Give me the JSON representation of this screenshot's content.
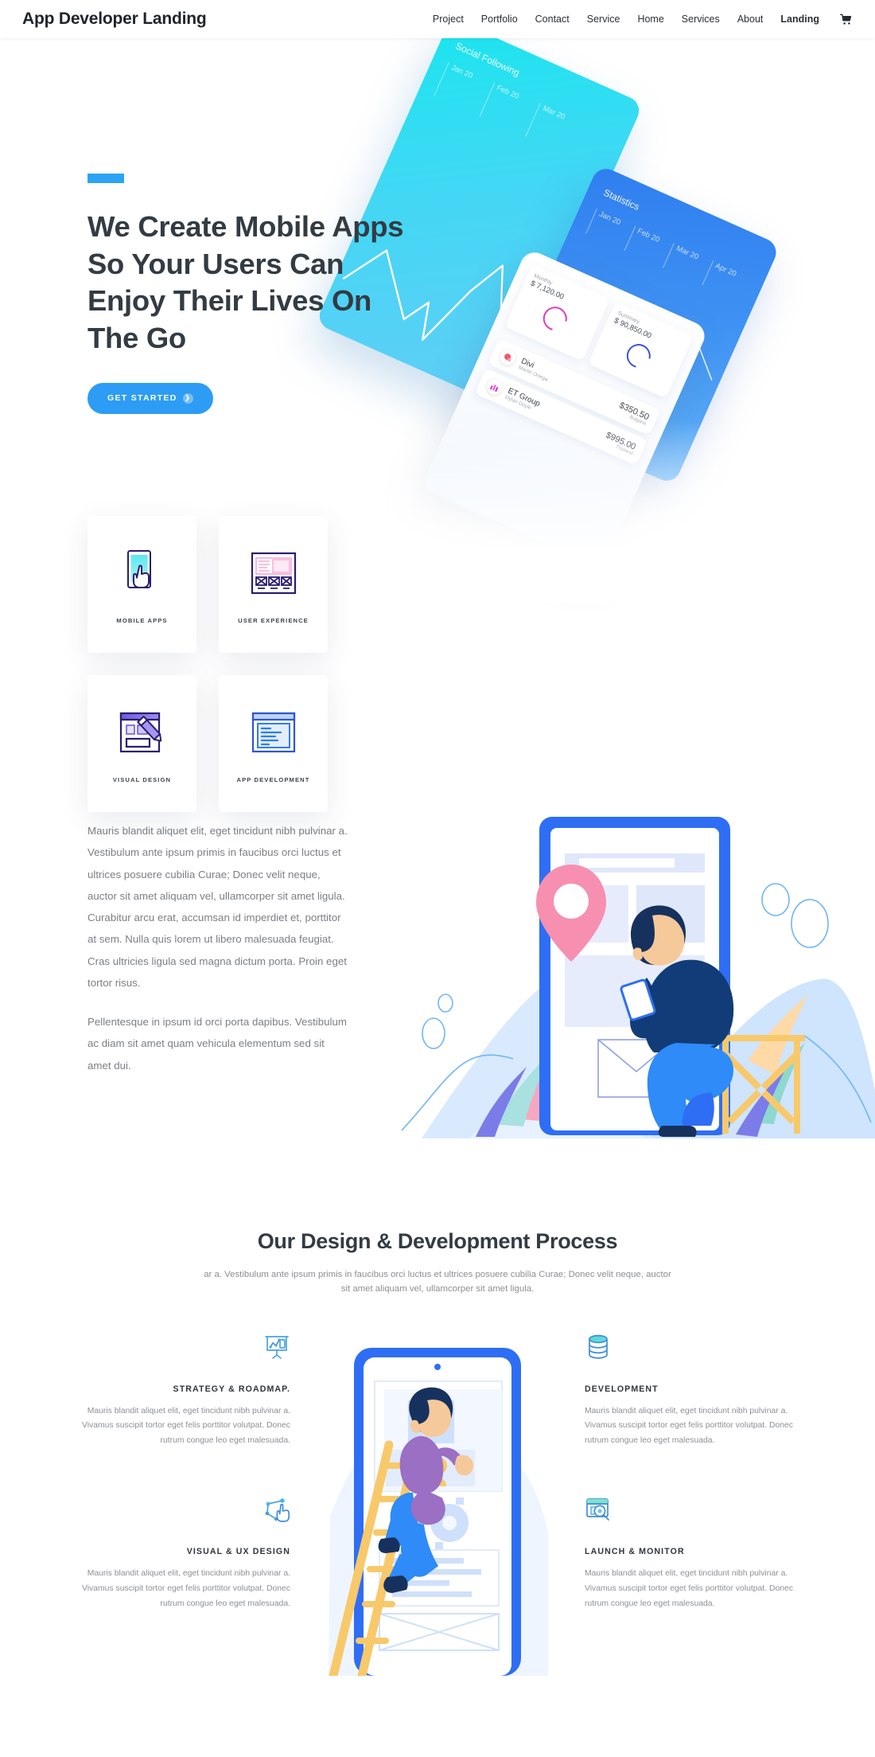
{
  "header": {
    "logo": "App Developer Landing",
    "nav": [
      {
        "label": "Project",
        "active": false
      },
      {
        "label": "Portfolio",
        "active": false
      },
      {
        "label": "Contact",
        "active": false
      },
      {
        "label": "Service",
        "active": false
      },
      {
        "label": "Home",
        "active": false
      },
      {
        "label": "Services",
        "active": false
      },
      {
        "label": "About",
        "active": false
      },
      {
        "label": "Landing",
        "active": true
      }
    ],
    "cart_icon": "shopping-cart-icon"
  },
  "hero": {
    "accent_color": "#2ca4f3",
    "title": "We Create Mobile Apps So Your Users Can Enjoy Their Lives On The Go",
    "cta_label": "GET STARTED",
    "cta_icon": "chevron-right-circle-icon",
    "cards": [
      {
        "label": "MOBILE APPS",
        "icon": "phone-tap-icon"
      },
      {
        "label": "USER EXPERIENCE",
        "icon": "wireframe-layout-icon"
      },
      {
        "label": "VISUAL DESIGN",
        "icon": "pencil-canvas-icon"
      },
      {
        "label": "APP DEVELOPMENT",
        "icon": "code-window-icon"
      }
    ],
    "art": {
      "social_card": {
        "title": "Social Following",
        "months": [
          "Jan 20",
          "Feb 20",
          "Mar 20"
        ]
      },
      "stats_card": {
        "title": "Statistics",
        "months": [
          "Jan 20",
          "Feb 20",
          "Mar 20",
          "Apr 20"
        ]
      },
      "dashboard_card": {
        "tiles": [
          {
            "caption": "Monthly",
            "value": "$ 7,120.00",
            "ring": "pink"
          },
          {
            "caption": "Summary",
            "value": "$ 90,850.00",
            "ring": "blue"
          }
        ],
        "transactions": [
          {
            "name": "Divi",
            "person": "Martin Ortega",
            "amount": "$350.50",
            "country": "Bulgaria"
          },
          {
            "name": "ET Group",
            "person": "Dylan Doyle",
            "amount": "$995.00",
            "country": "Thailand"
          }
        ]
      }
    }
  },
  "about": {
    "paragraph1": "Mauris blandit aliquet elit, eget tincidunt nibh pulvinar a. Vestibulum ante ipsum primis in faucibus orci luctus et ultrices posuere cubilia Curae; Donec velit neque, auctor sit amet aliquam vel, ullamcorper sit amet ligula. Curabitur arcu erat, accumsan id imperdiet et, porttitor at sem. Nulla quis lorem ut libero malesuada feugiat. Cras ultricies ligula sed magna dictum porta. Proin eget tortor risus.",
    "paragraph2": "Pellentesque in ipsum id orci porta dapibus. Vestibulum ac diam sit amet quam vehicula elementum sed sit amet dui.",
    "illustration": "man-on-stool-with-phone-illustration"
  },
  "process": {
    "title": "Our Design & Development Process",
    "subtitle": "ar a. Vestibulum ante ipsum primis in faucibus orci luctus et ultrices posuere cubilia Curae; Donec velit neque, auctor sit amet aliquam vel, ullamcorper sit amet ligula.",
    "illustration": "man-climbing-ladder-to-phone-illustration",
    "body": "Mauris blandit aliquet elit, eget tincidunt nibh pulvinar a. Vivamus suscipit tortor eget felis porttitor volutpat. Donec rutrum congue leo eget malesuada.",
    "items_left": [
      {
        "heading": "STRATEGY & ROADMAP.",
        "icon": "presentation-board-icon"
      },
      {
        "heading": "VISUAL & UX DESIGN",
        "icon": "node-tap-icon"
      }
    ],
    "items_right": [
      {
        "heading": "DEVELOPMENT",
        "icon": "database-icon"
      },
      {
        "heading": "LAUNCH & MONITOR",
        "icon": "browser-search-icon"
      }
    ]
  }
}
